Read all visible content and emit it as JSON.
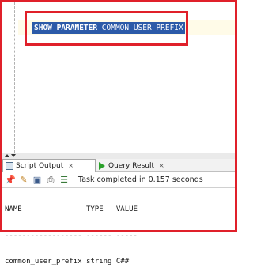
{
  "editor": {
    "code_keyword": "SHOW PARAMETER",
    "code_rest": " COMMON_USER_PREFIX"
  },
  "tabs": [
    {
      "label": "Script Output",
      "close": "×",
      "icon": "script-output-icon"
    },
    {
      "label": "Query Result",
      "close": "×",
      "icon": "run-query-icon"
    }
  ],
  "toolbar": {
    "icons": [
      "pin-icon",
      "eraser-icon",
      "save-icon",
      "print-icon",
      "list-icon"
    ],
    "status": "Task completed in 0.157 seconds"
  },
  "output": {
    "lines": [
      "NAME               TYPE   VALUE",
      "------------------ ------ -----",
      "common_user_prefix string C##"
    ]
  },
  "colors": {
    "annotation_red": "#e0202a",
    "selection_blue": "#2c5aa8"
  }
}
